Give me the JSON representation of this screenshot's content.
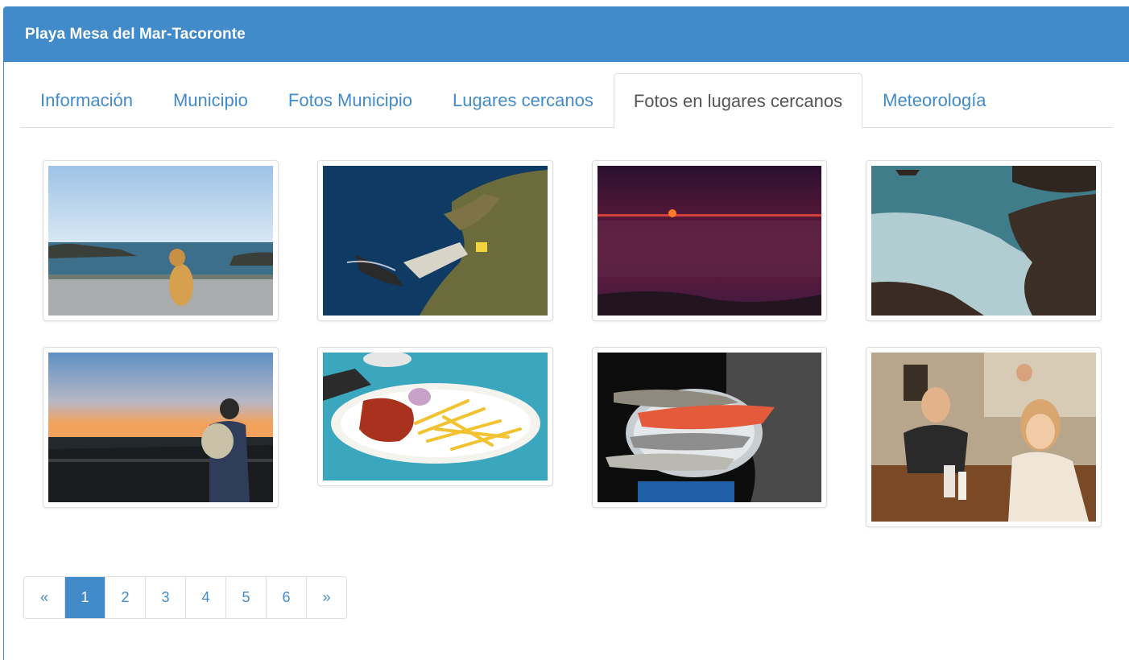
{
  "panel": {
    "title": "Playa Mesa del Mar-Tacoronte"
  },
  "tabs": [
    {
      "label": "Información",
      "active": false
    },
    {
      "label": "Municipio",
      "active": false
    },
    {
      "label": "Fotos Municipio",
      "active": false
    },
    {
      "label": "Lugares cercanos",
      "active": false
    },
    {
      "label": "Fotos en lugares cercanos",
      "active": true
    },
    {
      "label": "Meteorología",
      "active": false
    }
  ],
  "photos": [
    {
      "subject": "dog-on-terrace-by-sea"
    },
    {
      "subject": "coastal-cliffs-aerial"
    },
    {
      "subject": "sunset-over-sea"
    },
    {
      "subject": "rocky-coast-waves"
    },
    {
      "subject": "parent-child-sunset"
    },
    {
      "subject": "plate-with-fries"
    },
    {
      "subject": "fish-on-scale"
    },
    {
      "subject": "people-in-restaurant"
    }
  ],
  "pagination": {
    "prev": "«",
    "pages": [
      "1",
      "2",
      "3",
      "4",
      "5",
      "6"
    ],
    "current": "1",
    "next": "»"
  },
  "colors": {
    "primary": "#428bca",
    "border": "#dddddd"
  }
}
